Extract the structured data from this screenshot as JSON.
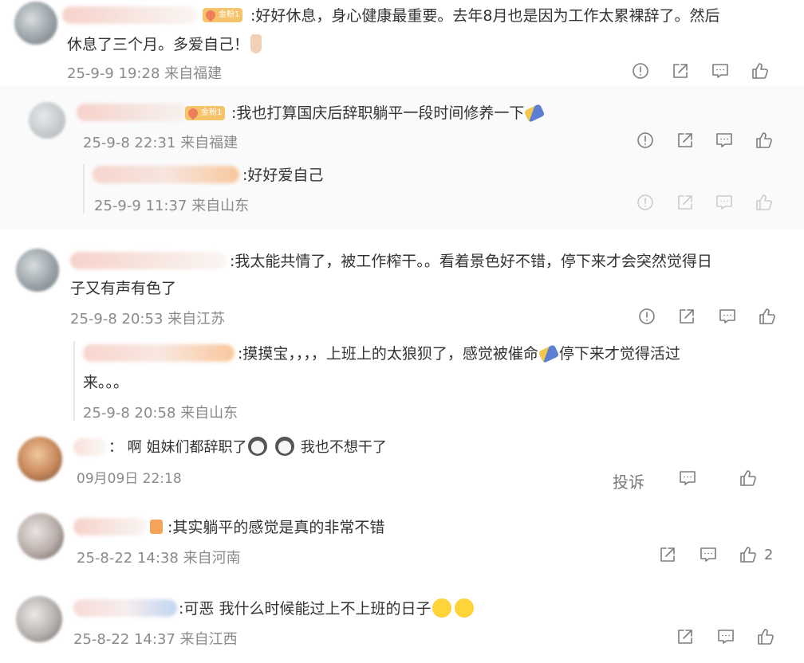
{
  "comments": [
    {
      "badge": "金粉1",
      "text_line1": ":好好休息，身心健康最重要。去年8月也是因为工作太累裸辞了。然后",
      "text_line2": "休息了三个月。多爱自己！",
      "emoji": "hand-emoji",
      "meta": "25-9-9 19:28 来自福建",
      "replies": [
        {
          "badge": "金粉1",
          "text": ":我也打算国庆后辞职躺平一段时间修养一下",
          "emoji": "hammer-emoji",
          "meta": "25-9-8 22:31 来自福建"
        },
        {
          "text": ":好好爱自己",
          "meta": "25-9-9 11:37 来自山东"
        }
      ]
    },
    {
      "text_line1": ":我太能共情了，被工作榨干。。看着景色好不错，停下来才会突然觉得日",
      "text_line2": "子又有声有色了",
      "meta": "25-9-8 20:53 来自江苏",
      "replies": [
        {
          "text_line1a": ":摸摸宝，，，，上班上的太狼狈了，感觉被催命",
          "text_line1b": "停下来才觉得活过",
          "text_line2": "来。。。",
          "meta": "25-9-8 20:58 来自山东"
        }
      ]
    },
    {
      "text_a": "：  啊 姐妹们都辞职了",
      "text_b": "我也不想干了",
      "meta": "09月09日 22:18",
      "report_label": "投诉"
    },
    {
      "text": ":其实躺平的感觉是真的非常不错",
      "meta": "25-8-22 14:38 来自河南",
      "like_count": "2"
    },
    {
      "text": ":可恶 我什么时候能过上不上班的日子",
      "meta": "25-8-22 14:37 来自江西"
    }
  ]
}
